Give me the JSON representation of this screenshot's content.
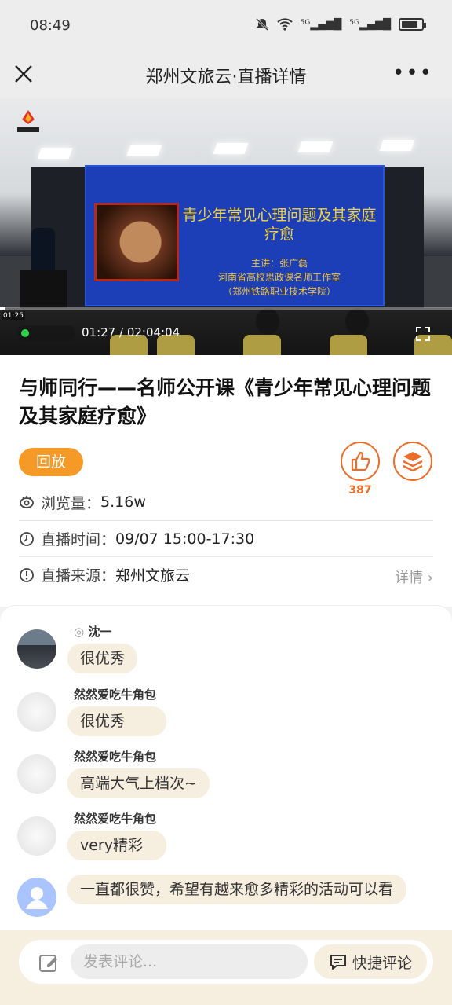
{
  "status_bar": {
    "time": "08:49",
    "signal1": "5G",
    "signal2": "5G"
  },
  "nav": {
    "title": "郑州文旅云·直播详情",
    "more": "•••"
  },
  "video": {
    "screen_title": "青少年常见心理问题及其家庭疗愈",
    "screen_presenter": "主讲：张广磊",
    "screen_org": "河南省高校思政课名师工作室",
    "screen_school": "（郑州铁路职业技术学院）",
    "mini_time": "01:25",
    "current_time": "01:27",
    "total_time": "02:04:04",
    "time_display": "01:27 / 02:04:04",
    "progress": 0.0117
  },
  "info": {
    "title": "与师同行——名师公开课《青少年常见心理问题及其家庭疗愈》",
    "badge": "回放",
    "likes": "387",
    "views_label": "浏览量：",
    "views_value": "5.16w",
    "time_label": "直播时间：",
    "time_value": "09/07 15:00-17:30",
    "source_label": "直播来源：",
    "source_value": "郑州文旅云",
    "detail_link": "详情"
  },
  "comments": [
    {
      "user": "沈一",
      "text": "很优秀",
      "avatar": "photo",
      "prefix": "◎"
    },
    {
      "user": "然然爱吃牛角包",
      "text": "很优秀",
      "avatar": "sketch"
    },
    {
      "user": "然然爱吃牛角包",
      "text": "高端大气上档次~",
      "avatar": "sketch"
    },
    {
      "user": "然然爱吃牛角包",
      "text": "very精彩",
      "avatar": "sketch"
    },
    {
      "user": "",
      "text": "一直都很赞，希望有越来愈多精彩的活动可以看",
      "avatar": "default"
    }
  ],
  "footer": {
    "placeholder": "发表评论...",
    "quick_label": "快捷评论"
  },
  "colors": {
    "accent": "#ec6d28",
    "badge": "#f59a26",
    "bubble": "#f6eedf"
  }
}
